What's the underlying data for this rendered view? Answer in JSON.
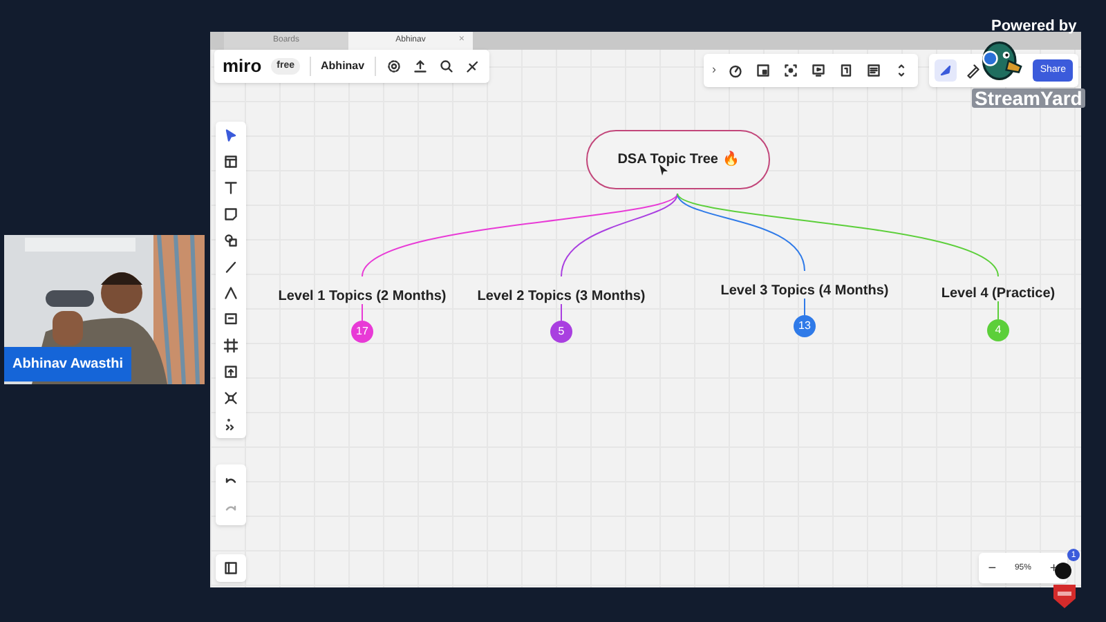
{
  "stream": {
    "powered_by": "Powered by",
    "brand": "StreamYard"
  },
  "camera": {
    "name_label": "Abhinav Awasthi"
  },
  "browser_tabs": [
    {
      "label": "Boards",
      "selected": false
    },
    {
      "label": "Abhinav",
      "selected": true,
      "close": "×"
    }
  ],
  "board_header": {
    "logo": "miro",
    "plan": "free",
    "board_name": "Abhinav"
  },
  "right_toolbar": {
    "expand": "›",
    "share": "Share"
  },
  "tree": {
    "root": "DSA Topic Tree 🔥",
    "branches": [
      {
        "label": "Level 1 Topics (2 Months)",
        "count": "17",
        "color": "#e83ad6"
      },
      {
        "label": "Level 2 Topics (3 Months)",
        "count": "5",
        "color": "#a93fe0"
      },
      {
        "label": "Level 3 Topics (4 Months)",
        "count": "13",
        "color": "#2f7ae8"
      },
      {
        "label": "Level 4 (Practice)",
        "count": "4",
        "color": "#5ccf3a"
      }
    ]
  },
  "zoom": {
    "minus": "−",
    "value": "95%",
    "plus": "+",
    "notifications": "1"
  }
}
